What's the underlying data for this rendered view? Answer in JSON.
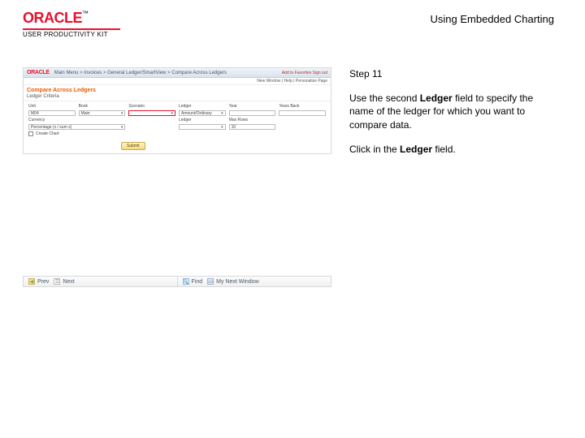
{
  "header": {
    "brand": "ORACLE",
    "tm": "™",
    "kit": "USER PRODUCTIVITY KIT",
    "title": "Using Embedded Charting"
  },
  "info": {
    "step": "Step 11",
    "p1a": "Use the second ",
    "p1b": "Ledger",
    "p1c": " field to specify the name of the ledger for which you want to compare data.",
    "p2a": "Click in the ",
    "p2b": "Ledger",
    "p2c": " field."
  },
  "app": {
    "logo": "ORACLE",
    "nav": "Main Menu  >  Invoices  >  General Ledger/SmartView  >  Compare Across Ledgers",
    "user": "Add to Favorites   Sign out",
    "subbar": "New Window | Help | Personalize Page",
    "sectionTitle": "Compare Across Ledgers",
    "sectionSub": "Ledger Criteria",
    "labels": {
      "unit": "Unit",
      "book": "Book",
      "scenario": "Scenario",
      "ledger": "Ledger",
      "year": "Year",
      "yearsback": "Years Back",
      "currency": "Currency",
      "maxrows": "Max Rows"
    },
    "values": {
      "unit": "M04",
      "book": "Main",
      "scenario": "",
      "ledger1": "Amount/Ordinary",
      "year": "",
      "yearsback": "",
      "ledger2": "",
      "currency": "Percentage (x / sum x)",
      "maxrows": "10",
      "chartLabel": "Create Chart"
    },
    "go": "Submit"
  },
  "pager": {
    "prev": "Prev",
    "next": "Next",
    "find": "Find",
    "window": "My Next Window"
  }
}
